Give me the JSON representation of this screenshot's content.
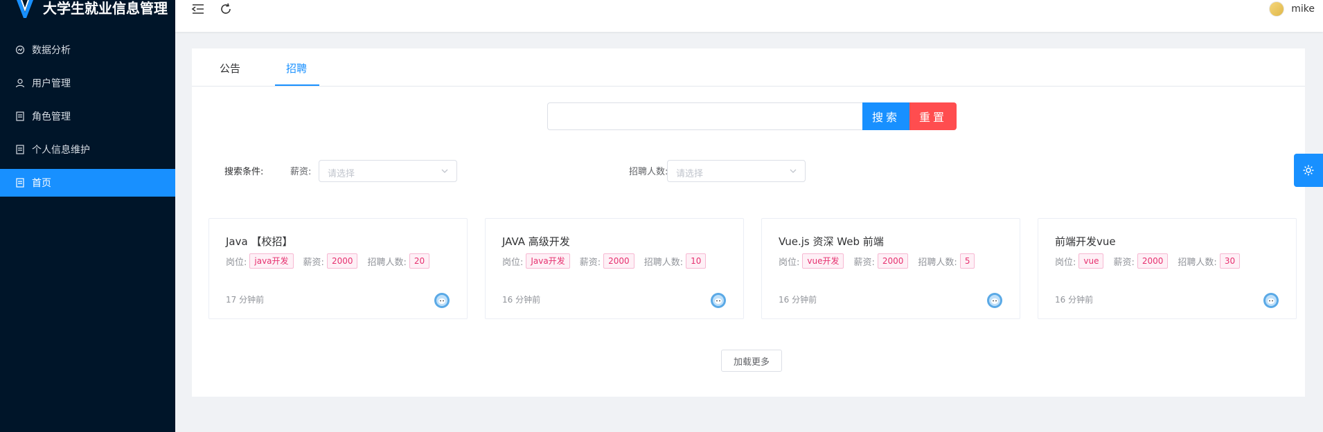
{
  "app": {
    "title": "大学生就业信息管理"
  },
  "sidebar": {
    "items": [
      {
        "label": "数据分析",
        "icon": "analytics-icon"
      },
      {
        "label": "用户管理",
        "icon": "user-icon"
      },
      {
        "label": "角色管理",
        "icon": "document-icon"
      },
      {
        "label": "个人信息维护",
        "icon": "document-icon"
      },
      {
        "label": "首页",
        "icon": "document-icon",
        "active": true
      }
    ]
  },
  "header": {
    "username": "mike"
  },
  "tabs": [
    {
      "label": "公告",
      "active": false
    },
    {
      "label": "招聘",
      "active": true
    }
  ],
  "search": {
    "value": "",
    "search_button": "搜索",
    "reset_button": "重置"
  },
  "filters": {
    "title": "搜索条件:",
    "salary_label": "薪资:",
    "salary_placeholder": "请选择",
    "count_label": "招聘人数:",
    "count_placeholder": "请选择"
  },
  "job_cards": [
    {
      "title": "Java 【校招】",
      "position_label": "岗位:",
      "position": "java开发",
      "salary_label": "薪资:",
      "salary": "2000",
      "count_label": "招聘人数:",
      "count": "20",
      "time": "17 分钟前"
    },
    {
      "title": "JAVA 高级开发",
      "position_label": "岗位:",
      "position": "Java开发",
      "salary_label": "薪资:",
      "salary": "2000",
      "count_label": "招聘人数:",
      "count": "10",
      "time": "16 分钟前"
    },
    {
      "title": "Vue.js 资深 Web 前端",
      "position_label": "岗位:",
      "position": "vue开发",
      "salary_label": "薪资:",
      "salary": "2000",
      "count_label": "招聘人数:",
      "count": "5",
      "time": "16 分钟前"
    },
    {
      "title": "前端开发vue",
      "position_label": "岗位:",
      "position": "vue",
      "salary_label": "薪资:",
      "salary": "2000",
      "count_label": "招聘人数:",
      "count": "30",
      "time": "16 分钟前"
    }
  ],
  "load_more": "加载更多",
  "colors": {
    "sidebar_bg": "#001529",
    "accent": "#1890ff",
    "danger": "#ff4d4f",
    "tag": "#e6306f"
  }
}
